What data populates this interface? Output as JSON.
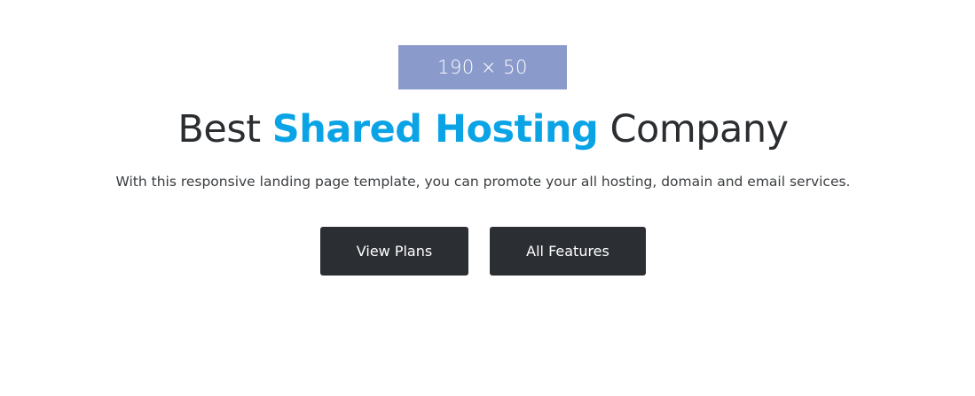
{
  "logo": {
    "placeholder_text": "190 × 50"
  },
  "hero": {
    "title_before": "Best",
    "title_accent": "Shared Hosting",
    "title_after": "Company",
    "subtitle": "With this responsive landing page template, you can promote your all hosting, domain and email services."
  },
  "buttons": {
    "view_plans": "View Plans",
    "all_features": "All Features"
  },
  "colors": {
    "accent": "#0aa4e6",
    "button_bg": "#2b2f33",
    "logo_bg": "#8a9bcb",
    "text": "#2b2e31"
  }
}
